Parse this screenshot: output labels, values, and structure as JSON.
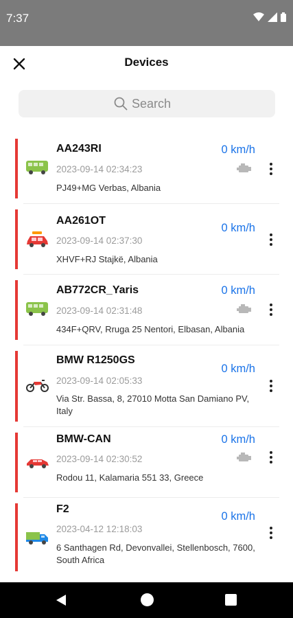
{
  "status_bar": {
    "time": "7:37"
  },
  "header": {
    "title": "Devices"
  },
  "search": {
    "placeholder": "Search"
  },
  "colors": {
    "accent": "#1a73e8",
    "status_strip": "#e53935",
    "bus": "#8bc34a",
    "car": "#e53935",
    "truck": "#1e88e5"
  },
  "devices": [
    {
      "name": "AA243RI",
      "time": "2023-09-14 02:34:23",
      "address": "PJ49+MG Verbas, Albania",
      "speed": "0 km/h",
      "icon": "bus-icon",
      "engine": true
    },
    {
      "name": "AA261OT",
      "time": "2023-09-14 02:37:30",
      "address": "XHVF+RJ Stajkë, Albania",
      "speed": "0 km/h",
      "icon": "car-luggage-icon",
      "engine": false
    },
    {
      "name": "AB772CR_Yaris",
      "time": "2023-09-14 02:31:48",
      "address": "434F+QRV, Rruga 25 Nentori, Elbasan, Albania",
      "speed": "0 km/h",
      "icon": "bus-icon",
      "engine": true
    },
    {
      "name": "BMW R1250GS",
      "time": "2023-09-14 02:05:33",
      "address": "Via Str. Bassa, 8, 27010 Motta San Damiano PV, Italy",
      "speed": "0 km/h",
      "icon": "motorcycle-icon",
      "engine": false
    },
    {
      "name": "BMW-CAN",
      "time": "2023-09-14 02:30:52",
      "address": "Rodou 11, Kalamaria 551 33, Greece",
      "speed": "0 km/h",
      "icon": "car-icon",
      "engine": true
    },
    {
      "name": "F2",
      "time": "2023-04-12 12:18:03",
      "address": "6 Santhagen Rd, Devonvallei, Stellenbosch, 7600, South Africa",
      "speed": "0 km/h",
      "icon": "truck-icon",
      "engine": false
    }
  ]
}
